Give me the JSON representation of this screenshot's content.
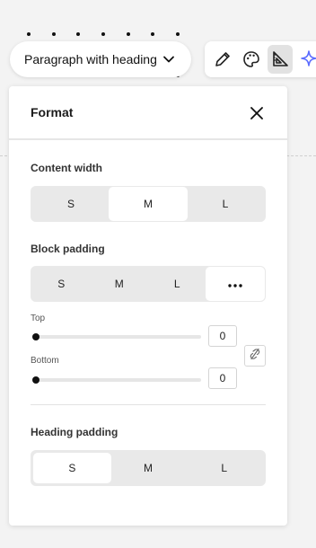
{
  "block_select": {
    "label": "Paragraph with heading",
    "icon": "chevron-down-icon"
  },
  "toolbar": {
    "tools": [
      {
        "name": "pencil-icon",
        "active": false
      },
      {
        "name": "palette-icon",
        "active": false
      },
      {
        "name": "ruler-triangle-icon",
        "active": true
      },
      {
        "name": "sparkle-icon",
        "active": false
      }
    ],
    "accent_sparkle": "#5b6cff"
  },
  "panel": {
    "title": "Format",
    "close_icon": "close-icon",
    "content_width": {
      "label": "Content width",
      "options": [
        "S",
        "M",
        "L"
      ],
      "selected": "M"
    },
    "block_padding": {
      "label": "Block padding",
      "options": [
        "S",
        "M",
        "L"
      ],
      "more_icon": "more-horizontal-icon",
      "selected": "more",
      "top": {
        "label": "Top",
        "value": "0"
      },
      "bottom": {
        "label": "Bottom",
        "value": "0"
      },
      "link_icon": "unlink-icon"
    },
    "heading_padding": {
      "label": "Heading padding",
      "options": [
        "S",
        "M",
        "L"
      ],
      "selected": "S"
    }
  }
}
